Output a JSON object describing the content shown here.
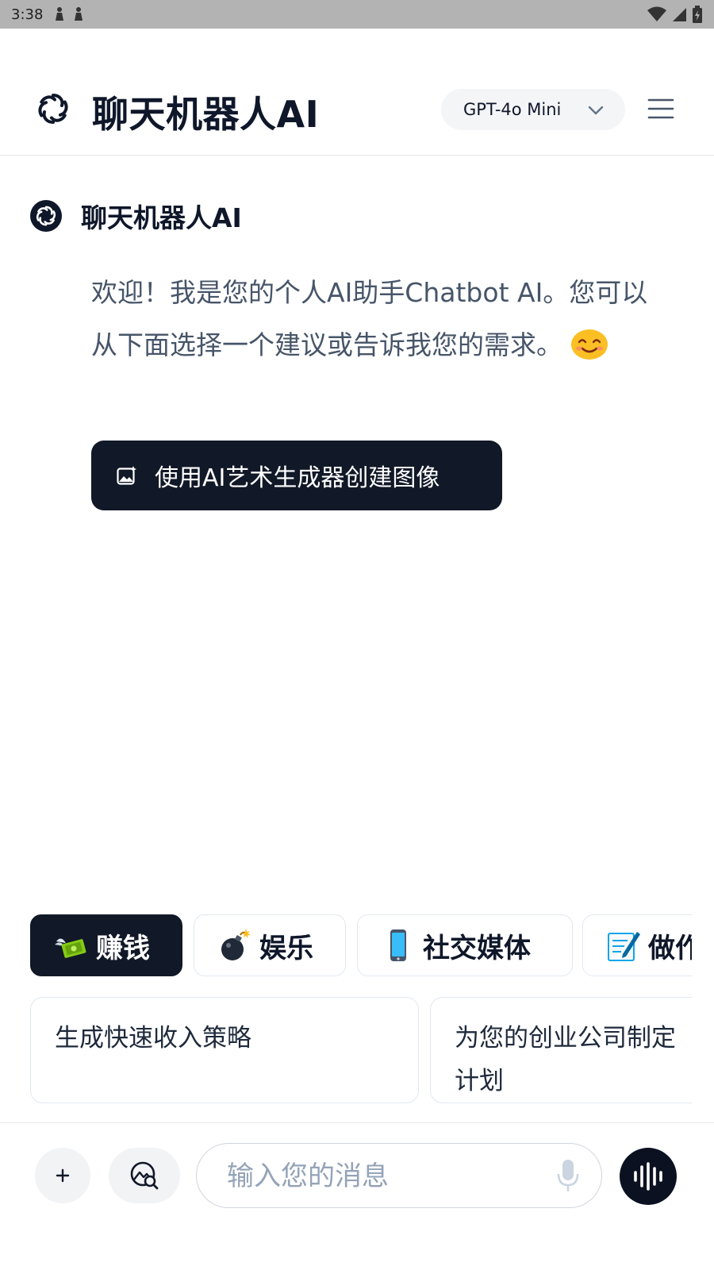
{
  "status_bar": {
    "time": "3:38"
  },
  "header": {
    "title": "聊天机器人AI",
    "model_selector": {
      "label": "GPT-4o Mini"
    }
  },
  "chat": {
    "bot_name": "聊天机器人AI",
    "welcome_message": "欢迎！我是您的个人AI助手Chatbot AI。您可以从下面选择一个建议或告诉我您的需求。",
    "cta_button_label": "使用AI艺术生成器创建图像"
  },
  "categories": [
    {
      "label": "赚钱",
      "icon": "money-wings-icon",
      "active": true
    },
    {
      "label": "娱乐",
      "icon": "bomb-icon",
      "active": false
    },
    {
      "label": "社交媒体",
      "icon": "mobile-phone-icon",
      "active": false
    },
    {
      "label": "做作",
      "icon": "memo-icon",
      "active": false
    }
  ],
  "suggestions": [
    {
      "text": "生成快速收入策略"
    },
    {
      "text": "为您的创业公司制定计划"
    }
  ],
  "input": {
    "placeholder": "输入您的消息"
  },
  "colors": {
    "primary": "#111827",
    "text_muted": "#475569",
    "border": "#e2e8f0"
  }
}
